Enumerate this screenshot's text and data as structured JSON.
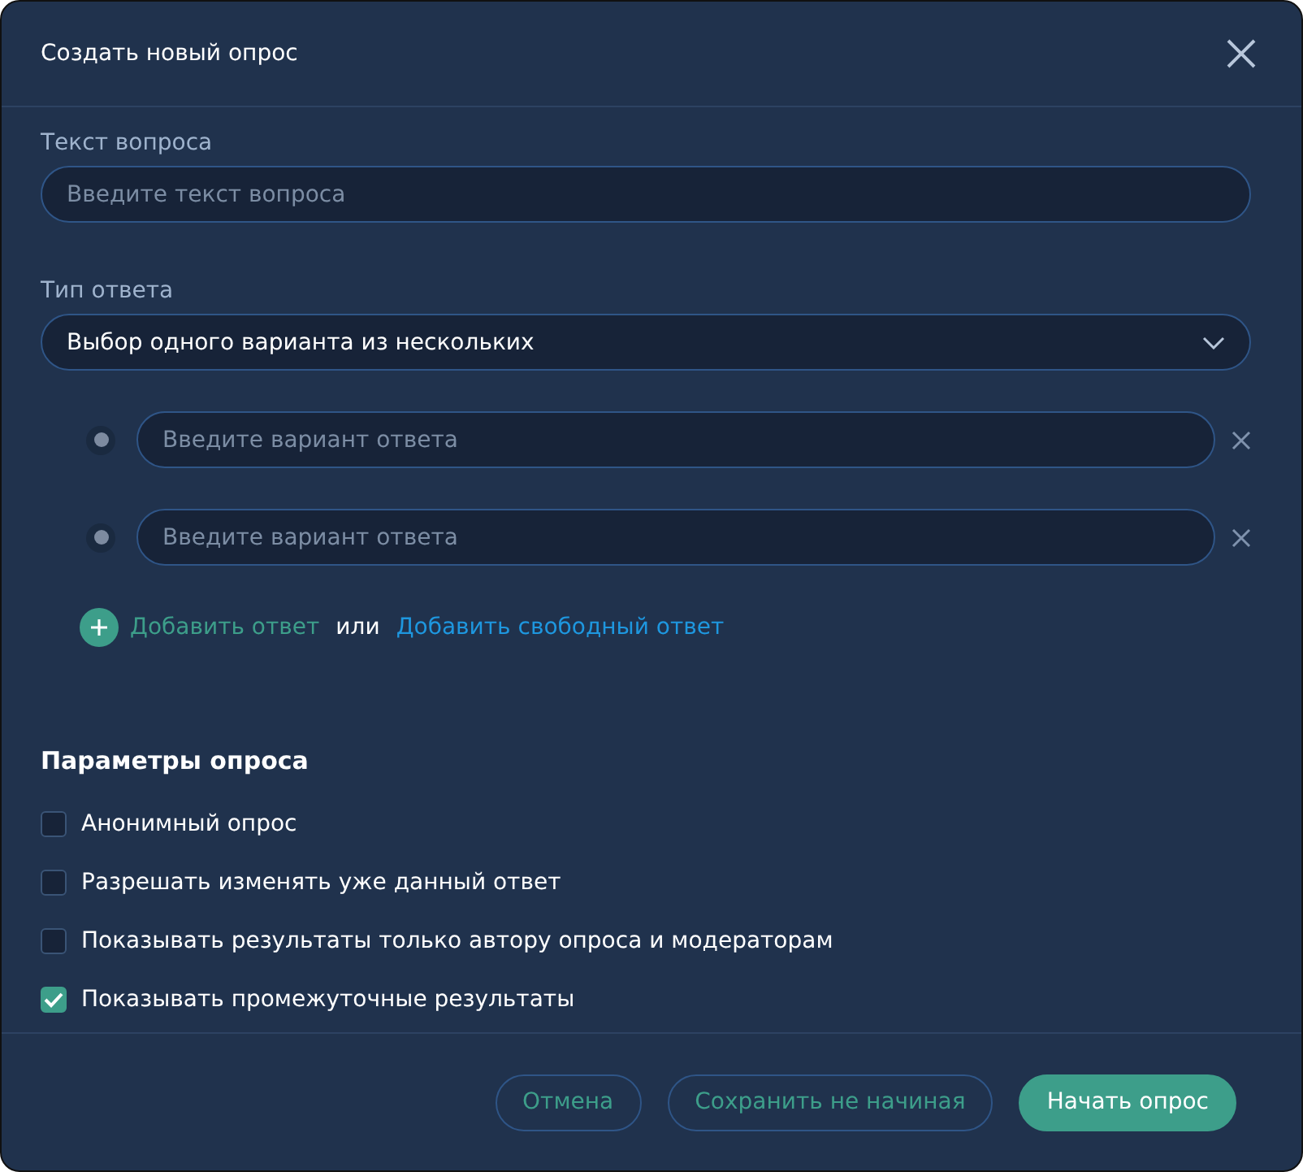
{
  "window": {
    "title": "Создать новый опрос"
  },
  "question": {
    "label": "Текст вопроса",
    "placeholder": "Введите текст вопроса"
  },
  "answer_type": {
    "label": "Тип ответа",
    "value": "Выбор одного варианта из нескольких"
  },
  "answers": [
    {
      "placeholder": "Введите вариант ответа"
    },
    {
      "placeholder": "Введите вариант ответа"
    }
  ],
  "add": {
    "add_answer": "Добавить ответ",
    "or": "или",
    "add_free_answer": "Добавить свободный ответ"
  },
  "options": {
    "title": "Параметры опроса",
    "items": [
      {
        "label": "Анонимный опрос",
        "checked": false
      },
      {
        "label": "Разрешать изменять уже данный ответ",
        "checked": false
      },
      {
        "label": "Показывать результаты только автору опроса и модераторам",
        "checked": false
      },
      {
        "label": "Показывать промежуточные результаты",
        "checked": true
      }
    ]
  },
  "buttons": [
    {
      "label": "Отмена",
      "kind": "outline"
    },
    {
      "label": "Сохранить не начиная",
      "kind": "outline"
    },
    {
      "label": "Начать опрос",
      "kind": "primary"
    }
  ]
}
